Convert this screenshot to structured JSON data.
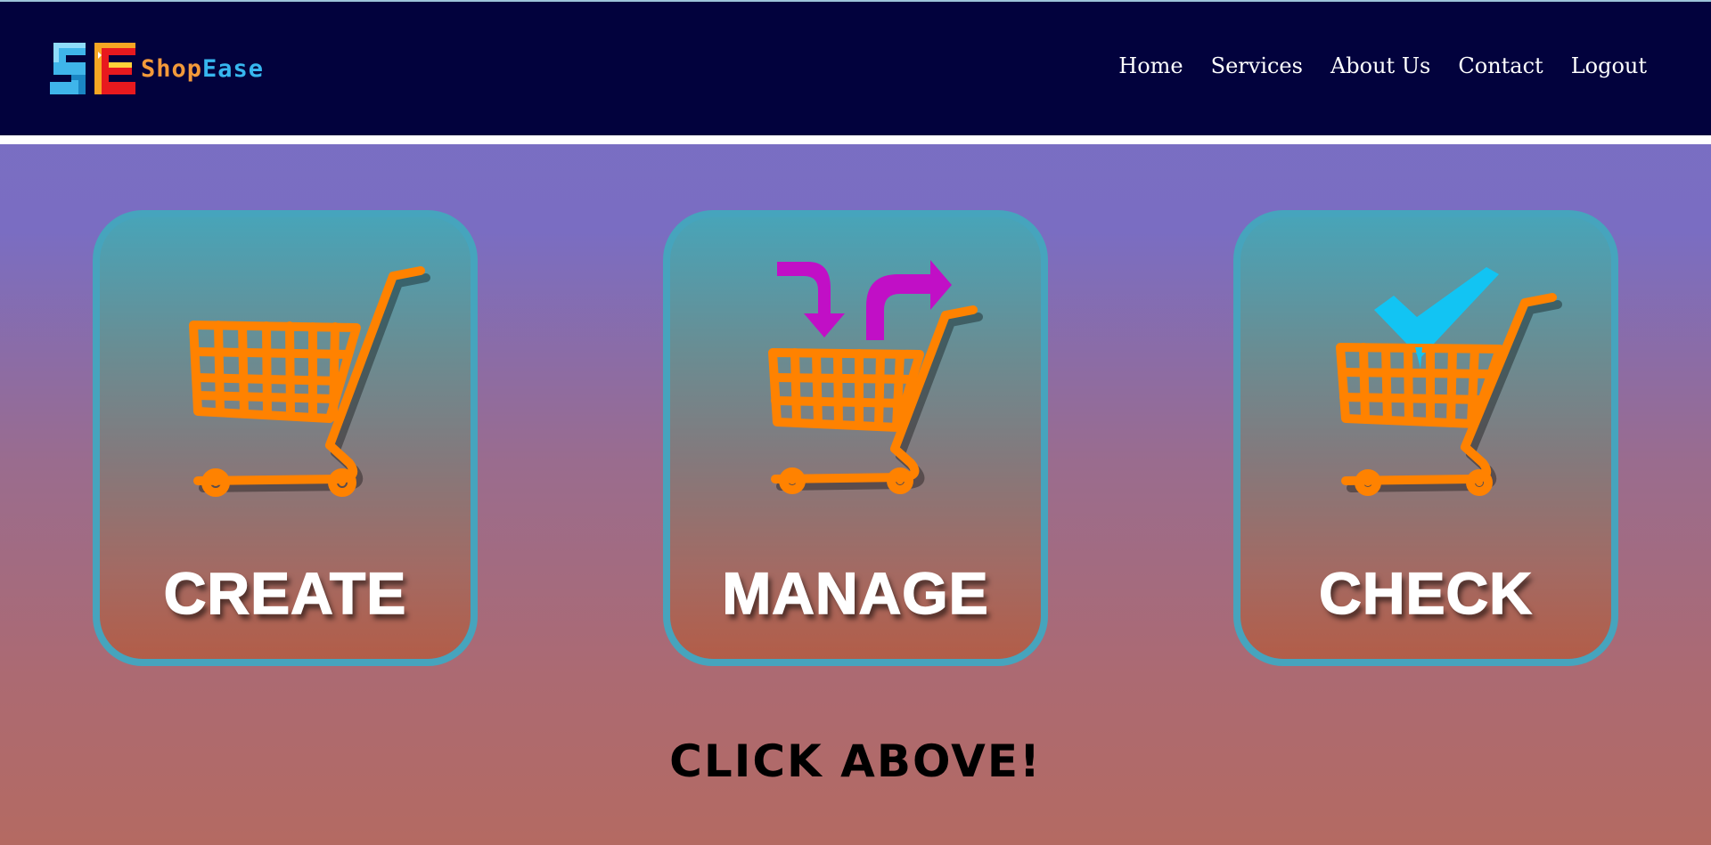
{
  "brand": {
    "part1": "Shop",
    "part2": "Ease",
    "logo_lettering": "SE"
  },
  "nav": {
    "items": [
      "Home",
      "Services",
      "About Us",
      "Contact",
      "Logout"
    ]
  },
  "cards": [
    {
      "label": "CREATE",
      "icon": "shopping-cart-icon"
    },
    {
      "label": "MANAGE",
      "icon": "cart-arrows-icon"
    },
    {
      "label": "CHECK",
      "icon": "cart-check-icon"
    }
  ],
  "footer_prompt": "CLICK ABOVE!",
  "colors": {
    "navbar": "#02023d",
    "card_border": "#46a4bd",
    "cart": "#ff8200",
    "arrows": "#c10fc6",
    "check": "#12c4f3",
    "brand_shop": "#f39a3a",
    "brand_ease": "#37b7ef"
  }
}
